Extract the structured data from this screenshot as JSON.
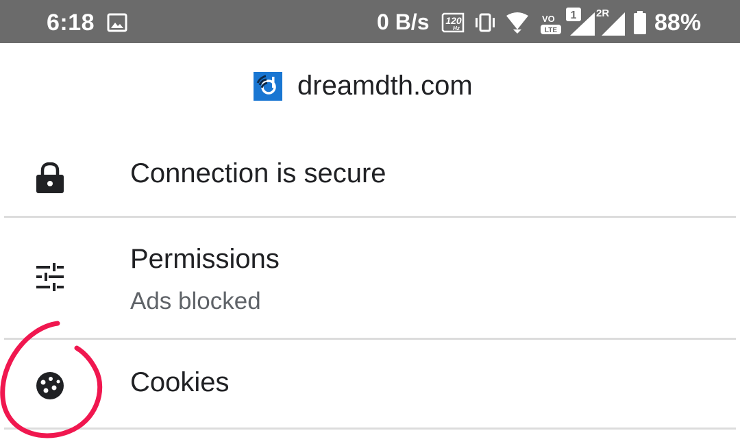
{
  "status_bar": {
    "time": "6:18",
    "net_speed": "0 B/s",
    "refresh_rate": "120",
    "refresh_unit": "Hz",
    "volte_top": "VO",
    "volte_bottom": "LTE",
    "sim1_label": "1",
    "sim2_label": "2R",
    "battery_percent": "88%",
    "battery_level": 0.88
  },
  "site": {
    "domain": "dreamdth.com",
    "favicon_color": "#1976d2"
  },
  "rows": [
    {
      "title": "Connection is secure",
      "icon": "lock-icon"
    },
    {
      "title": "Permissions",
      "subtitle": "Ads blocked",
      "icon": "tune-icon"
    },
    {
      "title": "Cookies",
      "icon": "cookie-icon"
    }
  ],
  "annotation": {
    "color": "#f0174f",
    "shape": "hand-drawn-circle"
  }
}
